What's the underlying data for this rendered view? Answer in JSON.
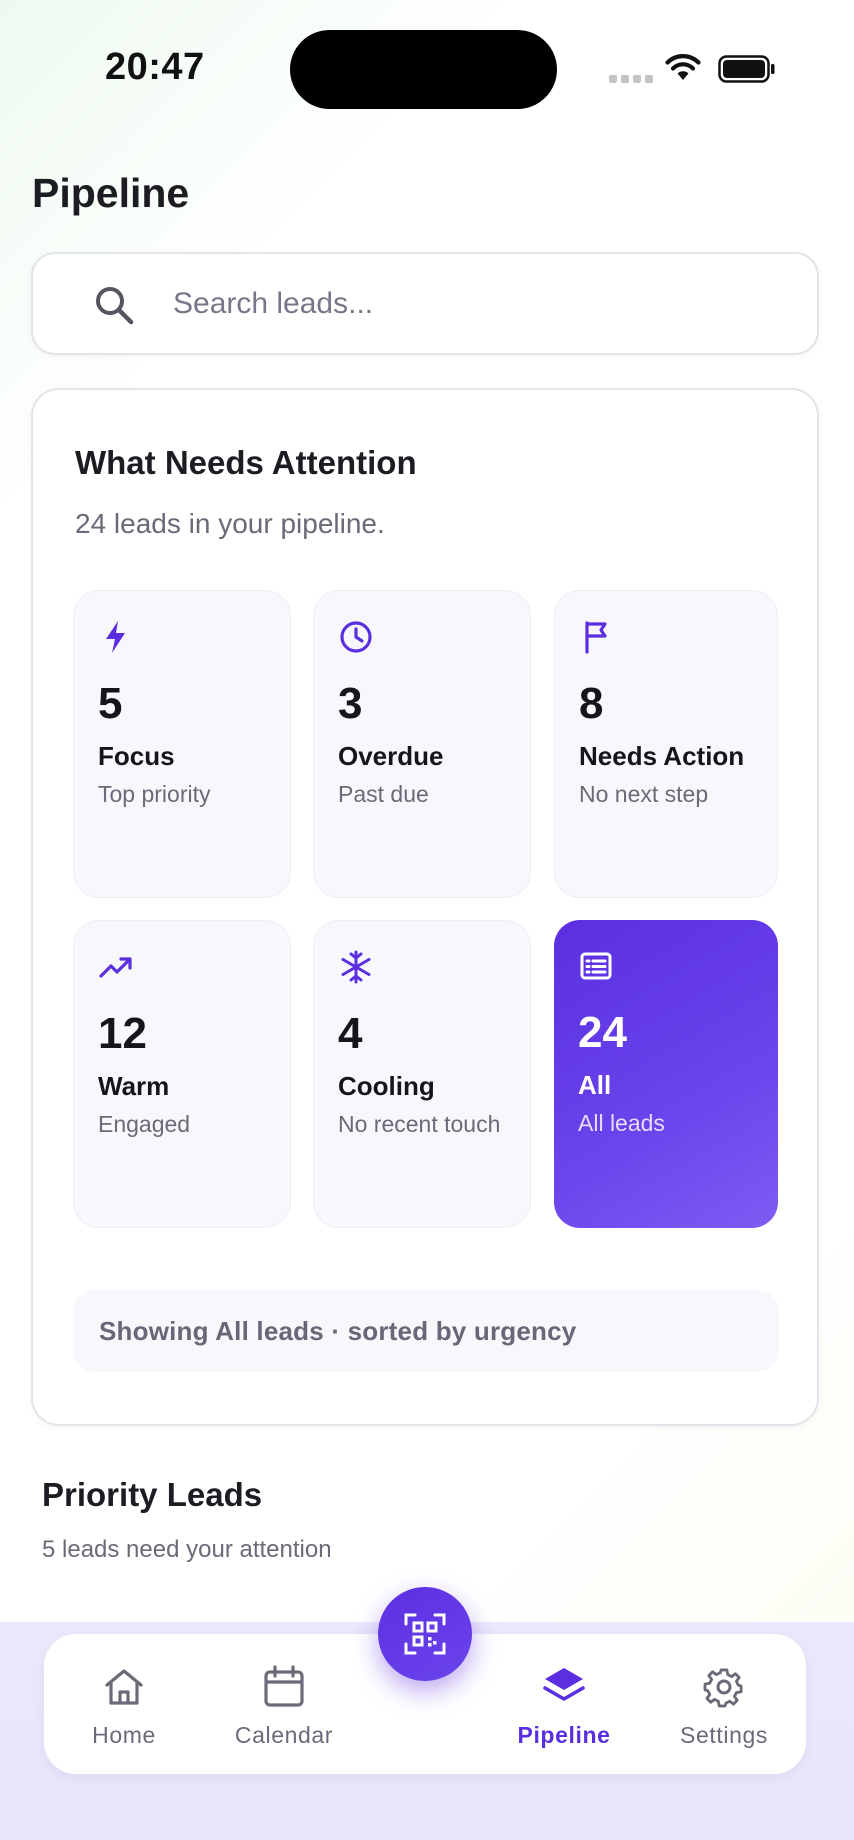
{
  "status": {
    "time": "20:47"
  },
  "page": {
    "title": "Pipeline"
  },
  "search": {
    "placeholder": "Search leads..."
  },
  "attention": {
    "title": "What Needs Attention",
    "subtitle": "24 leads in your pipeline.",
    "tiles": [
      {
        "icon": "bolt-icon",
        "count": "5",
        "label": "Focus",
        "desc": "Top priority"
      },
      {
        "icon": "clock-icon",
        "count": "3",
        "label": "Overdue",
        "desc": "Past due"
      },
      {
        "icon": "flag-icon",
        "count": "8",
        "label": "Needs Action",
        "desc": "No next step"
      },
      {
        "icon": "trending-up-icon",
        "count": "12",
        "label": "Warm",
        "desc": "Engaged"
      },
      {
        "icon": "snowflake-icon",
        "count": "4",
        "label": "Cooling",
        "desc": "No recent touch"
      },
      {
        "icon": "list-icon",
        "count": "24",
        "label": "All",
        "desc": "All leads",
        "selected": true
      }
    ],
    "sort_note": "Showing All leads · sorted by urgency"
  },
  "priority": {
    "title": "Priority Leads",
    "subtitle": "5 leads need your attention"
  },
  "tabs": [
    {
      "icon": "home-icon",
      "label": "Home"
    },
    {
      "icon": "calendar-icon",
      "label": "Calendar"
    },
    {
      "icon": "layers-icon",
      "label": "Pipeline",
      "active": true
    },
    {
      "icon": "gear-icon",
      "label": "Settings"
    }
  ],
  "fab": {
    "icon": "qr-scan-icon"
  },
  "colors": {
    "accent": "#5B2FE0",
    "muted": "#6A6A78",
    "tile_bg": "#F8F7FC"
  }
}
